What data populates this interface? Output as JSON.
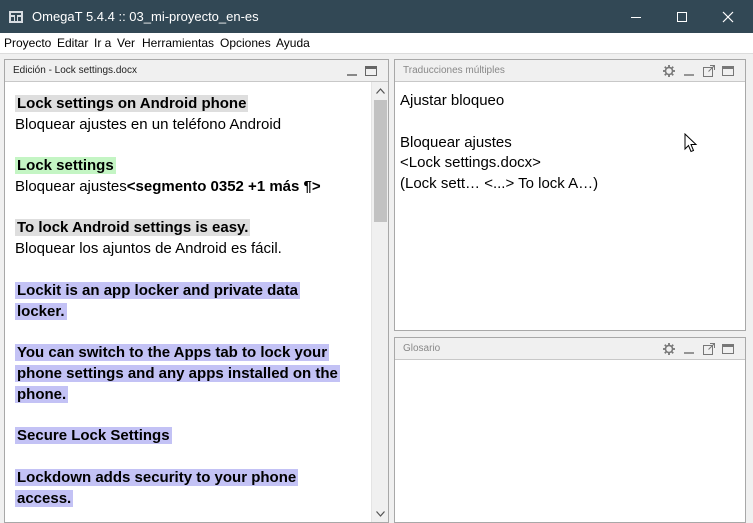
{
  "window": {
    "title": "OmegaT 5.4.4 :: 03_mi-proyecto_en-es"
  },
  "menu": [
    "Proyecto",
    "Editar",
    "Ir a",
    "Ver",
    "Herramientas",
    "Opciones",
    "Ayuda"
  ],
  "editor": {
    "title": "Edición - Lock settings.docx",
    "segments": [
      {
        "source": "Lock settings on Android phone",
        "target": "Bloquear ajustes en un teléfono Android"
      },
      {
        "source": "Lock settings",
        "target": "Bloquear ajustes",
        "tag": "<segmento 0352 +1 más ¶>"
      },
      {
        "source": "To lock Android settings is easy.",
        "target": "Bloquear los ajuntos de Android es fácil."
      },
      {
        "source": "Lockit is an app locker and private data",
        "source2": "locker."
      },
      {
        "source": "You can switch to the Apps tab to lock your",
        "source2": "phone settings and any apps installed on the",
        "source3": "phone."
      },
      {
        "source": "Secure Lock Settings"
      },
      {
        "source": "Lockdown adds security to your phone",
        "source2": "access."
      }
    ]
  },
  "tm": {
    "title": "Traducciones múltiples",
    "lines": [
      "Ajustar bloqueo",
      "Bloquear ajustes",
      "<Lock settings.docx>",
      "(Lock sett… <...> To lock A…)"
    ]
  },
  "glossary": {
    "title": "Glosario"
  },
  "colors": {
    "titlebar": "#324855",
    "highlight_gray": "#dedede",
    "highlight_green": "#c4f5c4",
    "highlight_blue": "#c3c2f5"
  },
  "icons": [
    "omegat-app-icon",
    "gear-icon",
    "minimize-icon",
    "undock-icon",
    "maximize-icon",
    "close-icon",
    "scroll-up-arrow-icon",
    "scroll-down-arrow-icon",
    "mouse-cursor-icon"
  ]
}
